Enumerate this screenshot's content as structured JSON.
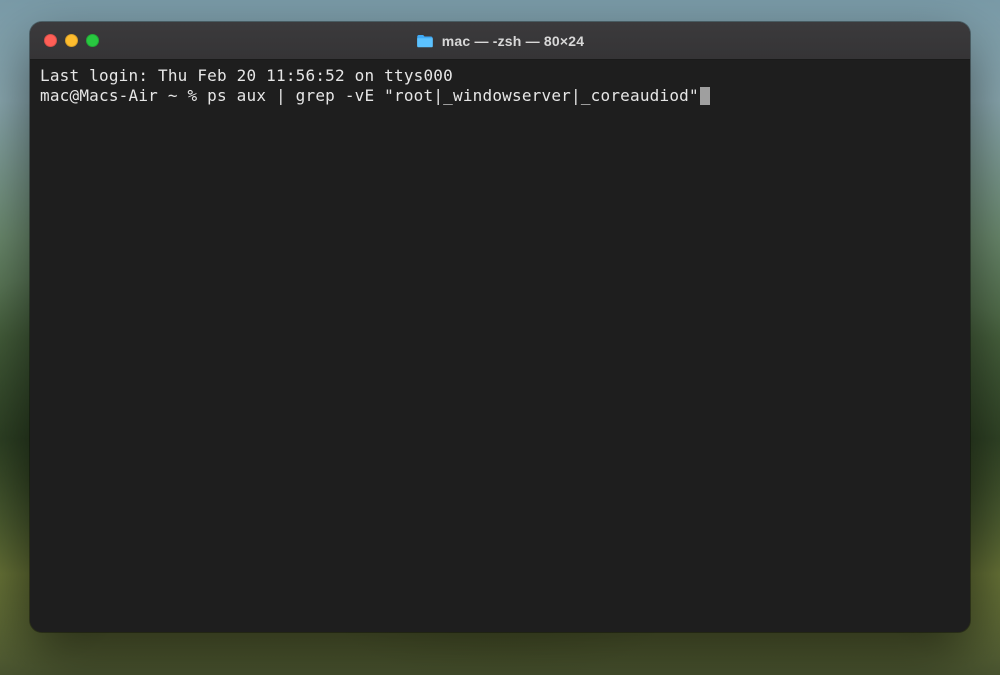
{
  "window": {
    "title": "mac — -zsh — 80×24",
    "icon": "folder-icon",
    "traffic_lights": {
      "close_color": "#ff5f57",
      "minimize_color": "#febc2e",
      "zoom_color": "#28c840"
    }
  },
  "terminal": {
    "last_login_line": "Last login: Thu Feb 20 11:56:52 on ttys000",
    "prompt": "mac@Macs-Air ~ % ",
    "command": "ps aux | grep -vE \"root|_windowserver|_coreaudiod\"",
    "cursor_visible": true
  },
  "colors": {
    "window_bg": "#1e1e1e",
    "titlebar_bg": "#3a393b",
    "text": "#e6e6e6",
    "cursor": "#9f9f9f"
  }
}
